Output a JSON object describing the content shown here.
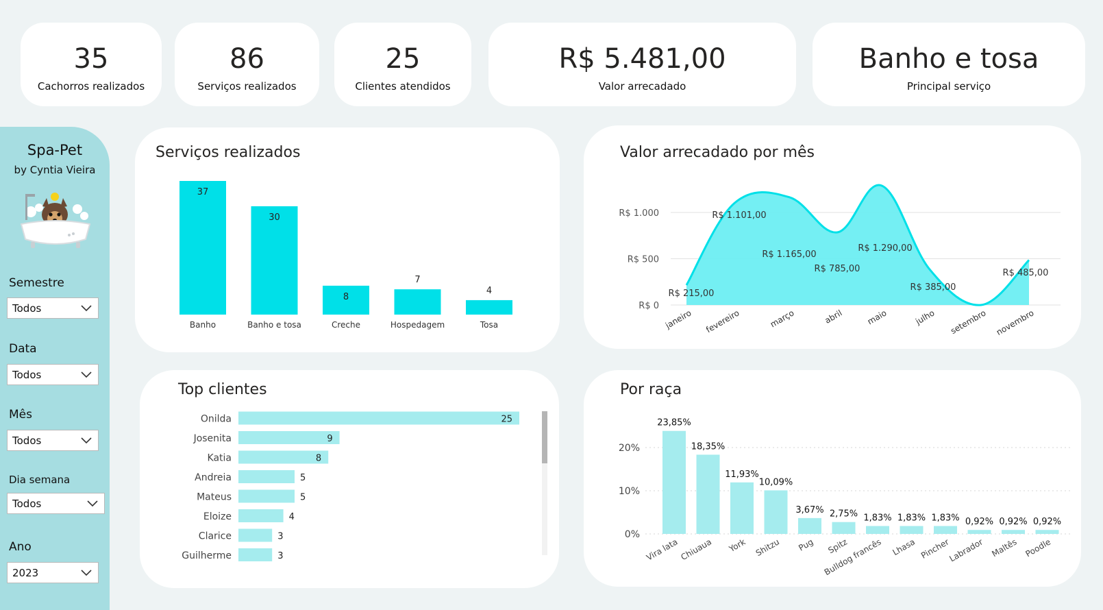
{
  "kpis": [
    {
      "value": "35",
      "label": "Cachorros realizados"
    },
    {
      "value": "86",
      "label": "Serviços realizados"
    },
    {
      "value": "25",
      "label": "Clientes atendidos"
    },
    {
      "value": "R$ 5.481,00",
      "label": "Valor arrecadado"
    },
    {
      "value": "Banho e tosa",
      "label": "Principal serviço"
    }
  ],
  "sidebar": {
    "title": "Spa-Pet",
    "subtitle": "by Cyntia Vieira",
    "slicers": [
      {
        "label": "Semestre",
        "value": "Todos"
      },
      {
        "label": "Data",
        "value": "Todos"
      },
      {
        "label": "Mês",
        "value": "Todos"
      },
      {
        "label": "Dia semana",
        "value": "Todos"
      },
      {
        "label": "Ano",
        "value": "2023"
      }
    ]
  },
  "panels": {
    "services_title": "Serviços realizados",
    "revenue_title": "Valor arrecadado por mês",
    "clients_title": "Top clientes",
    "breed_title": "Por raça"
  },
  "colors": {
    "accent": "#00e0e8",
    "area": "#6deef2",
    "light_bar": "#a5ecee",
    "sidebar": "#a6dde1"
  },
  "chart_data": [
    {
      "type": "bar",
      "title": "Serviços realizados",
      "categories": [
        "Banho",
        "Banho e tosa",
        "Creche",
        "Hospedagem",
        "Tosa"
      ],
      "values": [
        37,
        30,
        8,
        7,
        4
      ],
      "labels": [
        "37",
        "30",
        "8",
        "7",
        "4"
      ],
      "ylim": [
        0,
        37
      ]
    },
    {
      "type": "area",
      "title": "Valor arrecadado por mês",
      "categories": [
        "janeiro",
        "fevereiro",
        "março",
        "abril",
        "maio",
        "julho",
        "setembro",
        "novembro"
      ],
      "values": [
        215,
        1101,
        1165,
        785,
        1290,
        385,
        0,
        485
      ],
      "labels": [
        "R$ 215,00",
        "R$ 1.101,00",
        "R$ 1.165,00",
        "R$ 785,00",
        "R$ 1.290,00",
        "R$ 385,00",
        "",
        "R$ 485,00"
      ],
      "yticks": [
        "R$ 0",
        "R$ 500",
        "R$ 1.000"
      ],
      "ylim": [
        0,
        1300
      ],
      "grid": true
    },
    {
      "type": "bar",
      "title": "Top clientes",
      "categories": [
        "Onilda",
        "Josenita",
        "Katia",
        "Andreia",
        "Mateus",
        "Eloize",
        "Clarice",
        "Guilherme"
      ],
      "values": [
        25,
        9,
        8,
        5,
        5,
        4,
        3,
        3
      ],
      "labels": [
        "25",
        "9",
        "8",
        "5",
        "5",
        "4",
        "3",
        "3"
      ]
    },
    {
      "type": "bar",
      "title": "Por raça",
      "categories": [
        "Vira lata",
        "Chiuaua",
        "York",
        "Shitzu",
        "Pug",
        "Spitz",
        "Bulldog francês",
        "Lhasa",
        "Pincher",
        "Labrador",
        "Maltês",
        "Poodle"
      ],
      "values": [
        23.85,
        18.35,
        11.93,
        10.09,
        3.67,
        2.75,
        1.83,
        1.83,
        1.83,
        0.92,
        0.92,
        0.92
      ],
      "labels": [
        "23,85%",
        "18,35%",
        "11,93%",
        "10,09%",
        "3,67%",
        "2,75%",
        "1,83%",
        "1,83%",
        "1,83%",
        "0,92%",
        "0,92%",
        "0,92%"
      ],
      "yticks": [
        "0%",
        "10%",
        "20%"
      ],
      "ylim": [
        0,
        25
      ],
      "grid": true
    }
  ]
}
